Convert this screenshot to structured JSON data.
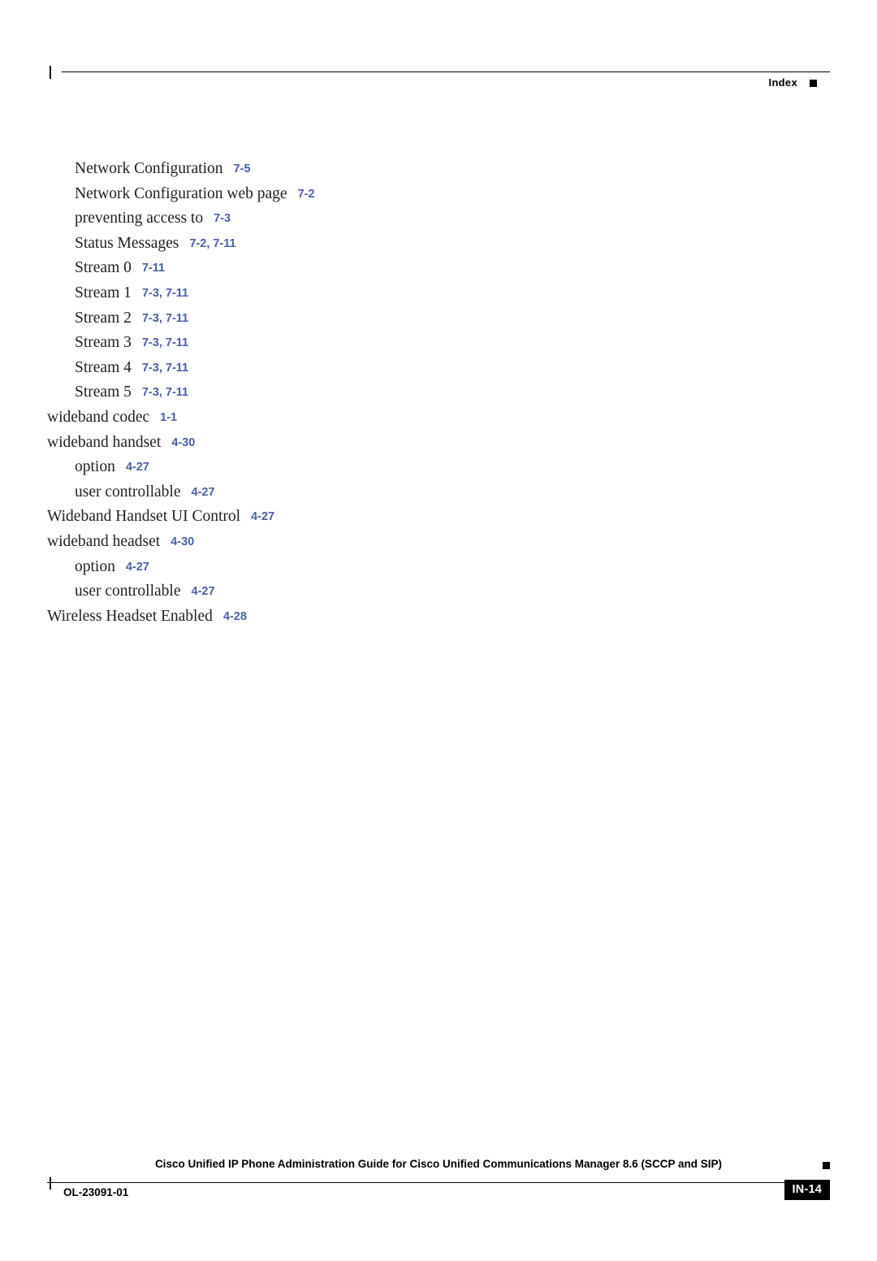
{
  "header": {
    "label": "Index"
  },
  "index_entries": [
    {
      "term": "Network Configuration",
      "pages": "7-5",
      "level": 1
    },
    {
      "term": "Network Configuration web page",
      "pages": "7-2",
      "level": 1
    },
    {
      "term": "preventing access to",
      "pages": "7-3",
      "level": 2
    },
    {
      "term": "Status Messages",
      "pages": "7-2, 7-11",
      "level": 2
    },
    {
      "term": "Stream 0",
      "pages": "7-11",
      "level": 2
    },
    {
      "term": "Stream 1",
      "pages": "7-3, 7-11",
      "level": 2
    },
    {
      "term": "Stream 2",
      "pages": "7-3, 7-11",
      "level": 2
    },
    {
      "term": "Stream 3",
      "pages": "7-3, 7-11",
      "level": 2
    },
    {
      "term": "Stream 4",
      "pages": "7-3, 7-11",
      "level": 2
    },
    {
      "term": "Stream 5",
      "pages": "7-3, 7-11",
      "level": 2
    },
    {
      "term": "wideband codec",
      "pages": "1-1",
      "level": 0
    },
    {
      "term": "wideband handset",
      "pages": "4-30",
      "level": 0
    },
    {
      "term": "option",
      "pages": "4-27",
      "level": 1
    },
    {
      "term": "user controllable",
      "pages": "4-27",
      "level": 1
    },
    {
      "term": "Wideband Handset UI Control",
      "pages": "4-27",
      "level": 0
    },
    {
      "term": "wideband headset",
      "pages": "4-30",
      "level": 0
    },
    {
      "term": "option",
      "pages": "4-27",
      "level": 1
    },
    {
      "term": "user controllable",
      "pages": "4-27",
      "level": 1
    },
    {
      "term": "Wireless Headset Enabled",
      "pages": "4-28",
      "level": 0
    }
  ],
  "footer": {
    "title": "Cisco Unified IP Phone Administration Guide for Cisco Unified Communications Manager 8.6 (SCCP and SIP)",
    "doc_id": "OL-23091-01",
    "page_number": "IN-14"
  },
  "colors": {
    "page_ref": "#4a5fa5",
    "text": "#231f20"
  }
}
